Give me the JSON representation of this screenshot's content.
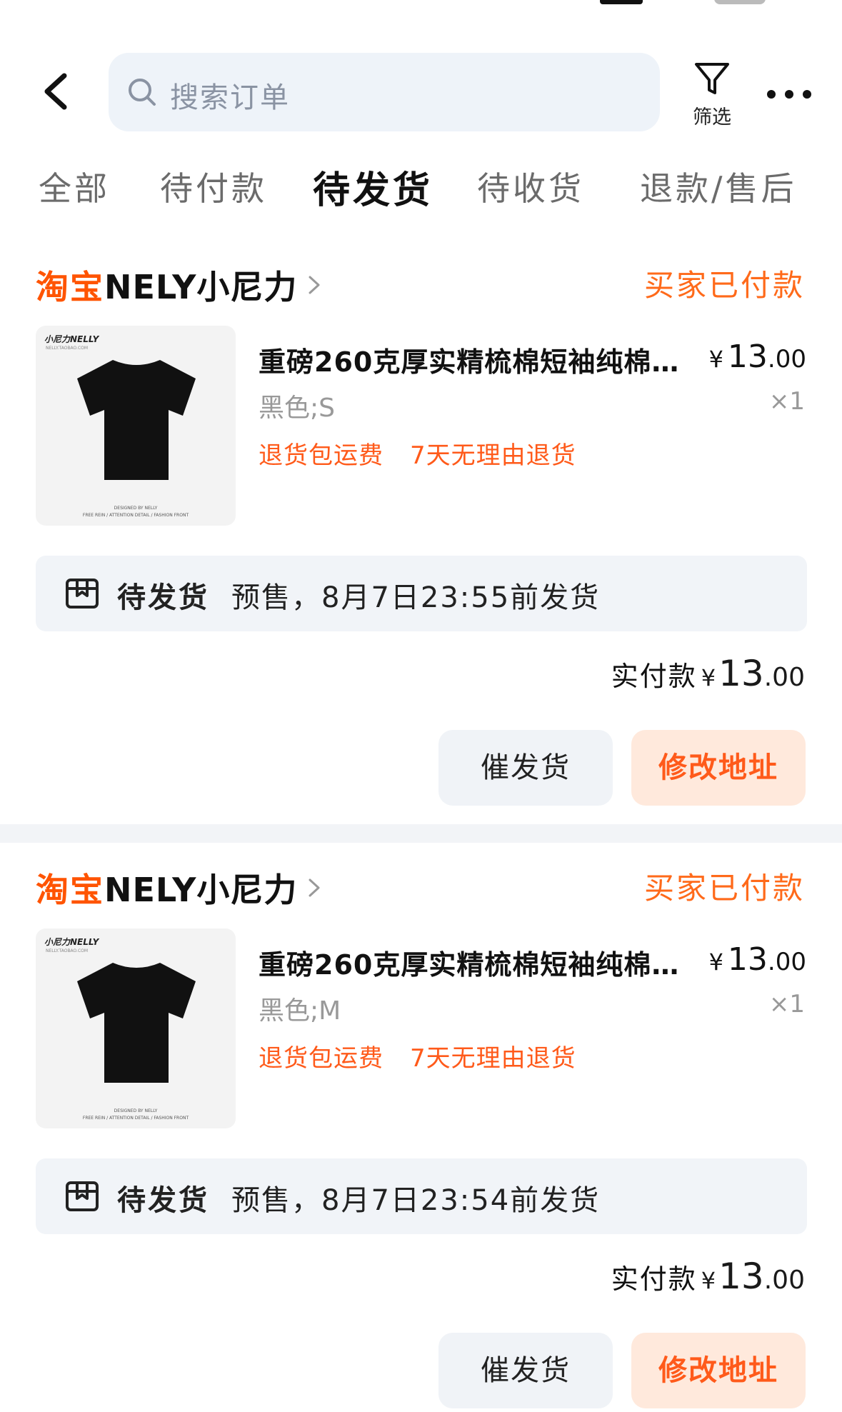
{
  "header": {
    "search_placeholder": "搜索订单",
    "filter_label": "筛选"
  },
  "tabs": [
    {
      "label": "全部"
    },
    {
      "label": "待付款"
    },
    {
      "label": "待发货"
    },
    {
      "label": "待收货"
    },
    {
      "label": "退款/售后"
    }
  ],
  "active_tab": "待发货",
  "colors": {
    "accent": "#ff5400",
    "search_bg": "#eef3f9",
    "card_bg": "#f1f4f8",
    "address_button_bg": "#ffe9dc"
  },
  "orders": [
    {
      "platform": "淘宝",
      "shop": "NELY小尼力",
      "status": "买家已付款",
      "thumb_brand": "小尼力NELLY",
      "thumb_brand_sub": "NELLY.TAOBAO.COM",
      "thumb_caption1": "DESIGNED BY NELLY",
      "thumb_caption2": "FREE REIN  /  ATTENTION DETAIL  /  FASHION FRONT",
      "title": "重磅260克厚实精梳棉短袖纯棉…",
      "price_currency": "¥",
      "price_int": "13",
      "price_dec": ".00",
      "sku": "黑色;S",
      "qty": "×1",
      "tag1": "退货包运费",
      "tag2": "7天无理由退货",
      "ship_status": "待发货",
      "ship_info": "预售，8月7日23:55前发货",
      "paid_label": "实付款",
      "paid_currency": "¥",
      "paid_int": "13",
      "paid_dec": ".00",
      "btn_urge": "催发货",
      "btn_address": "修改地址"
    },
    {
      "platform": "淘宝",
      "shop": "NELY小尼力",
      "status": "买家已付款",
      "thumb_brand": "小尼力NELLY",
      "thumb_brand_sub": "NELLY.TAOBAO.COM",
      "thumb_caption1": "DESIGNED BY NELLY",
      "thumb_caption2": "FREE REIN  /  ATTENTION DETAIL  /  FASHION FRONT",
      "title": "重磅260克厚实精梳棉短袖纯棉…",
      "price_currency": "¥",
      "price_int": "13",
      "price_dec": ".00",
      "sku": "黑色;M",
      "qty": "×1",
      "tag1": "退货包运费",
      "tag2": "7天无理由退货",
      "ship_status": "待发货",
      "ship_info": "预售，8月7日23:54前发货",
      "paid_label": "实付款",
      "paid_currency": "¥",
      "paid_int": "13",
      "paid_dec": ".00",
      "btn_urge": "催发货",
      "btn_address": "修改地址"
    }
  ]
}
